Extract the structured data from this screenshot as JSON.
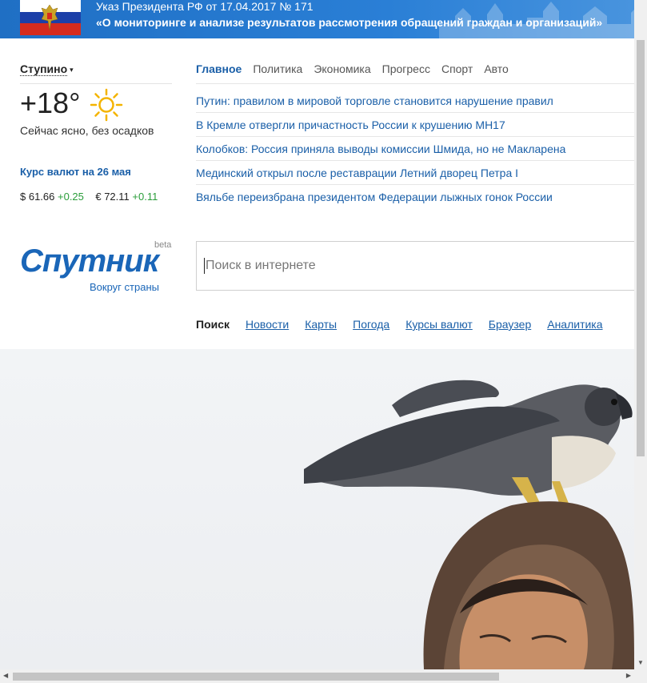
{
  "banner": {
    "line1": "Указ Президента РФ от 17.04.2017 № 171",
    "line2": "«О мониторинге и анализе результатов рассмотрения обращений граждан и организаций»"
  },
  "weather": {
    "city": "Ступино",
    "temperature": "+18°",
    "description": "Сейчас ясно, без осадков",
    "icon": "sun-icon"
  },
  "rates": {
    "title": "Курс валют на 26 мая",
    "usd_label": "$ 61.66",
    "usd_change": "+0.25",
    "eur_label": "€ 72.11",
    "eur_change": "+0.11"
  },
  "tabs": [
    "Главное",
    "Политика",
    "Экономика",
    "Прогресс",
    "Спорт",
    "Авто"
  ],
  "news": [
    "Путин: правилом в мировой торговле становится нарушение правил",
    "В Кремле отвергли причастность России к крушению MH17",
    "Колобков: Россия приняла выводы комиссии Шмида, но не Макларена",
    "Мединский открыл после реставрации Летний дворец Петра I",
    "Вяльбе переизбрана президентом Федерации лыжных гонок России"
  ],
  "logo": {
    "name": "Спутник",
    "beta": "beta",
    "tagline": "Вокруг страны"
  },
  "search": {
    "placeholder": "Поиск в интернете",
    "value": ""
  },
  "services": [
    "Поиск",
    "Новости",
    "Карты",
    "Погода",
    "Курсы валют",
    "Браузер",
    "Аналитика"
  ],
  "colors": {
    "accent": "#1a5fa8",
    "positive": "#2a9d3a",
    "banner": "#2a7fd6"
  }
}
